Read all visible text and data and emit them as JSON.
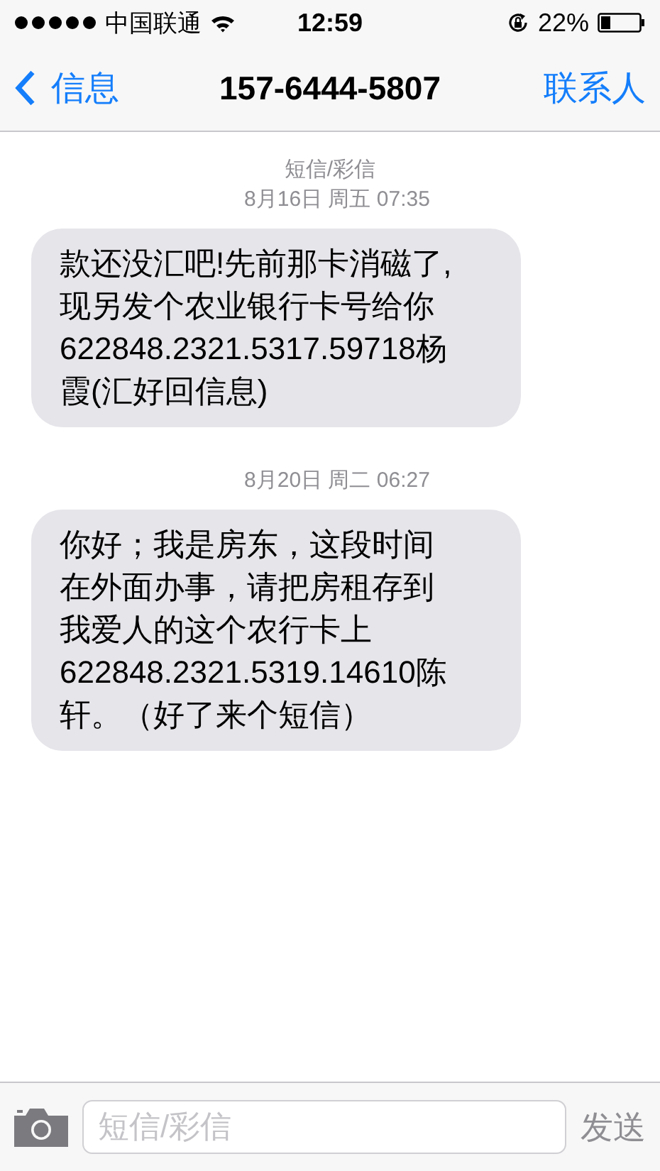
{
  "status_bar": {
    "carrier": "中国联通",
    "time": "12:59",
    "battery": "22%"
  },
  "nav": {
    "back": "信息",
    "title": "157-6444-5807",
    "action": "联系人"
  },
  "thread": {
    "header": "短信/彩信",
    "groups": [
      {
        "timestamp": "8月16日 周五 07:35",
        "messages": [
          {
            "text": "款还没汇吧!先前那卡消磁了,现另发个农业银行卡号给你622848.2321.5317.59718杨霞(汇好回信息)"
          }
        ]
      },
      {
        "timestamp": "8月20日 周二 06:27",
        "messages": [
          {
            "text": "你好；我是房东，这段时间在外面办事，请把房租存到我爱人的这个农行卡上622848.2321.5319.14610陈轩。（好了来个短信）"
          }
        ]
      }
    ]
  },
  "composer": {
    "placeholder": "短信/彩信",
    "send": "发送"
  }
}
